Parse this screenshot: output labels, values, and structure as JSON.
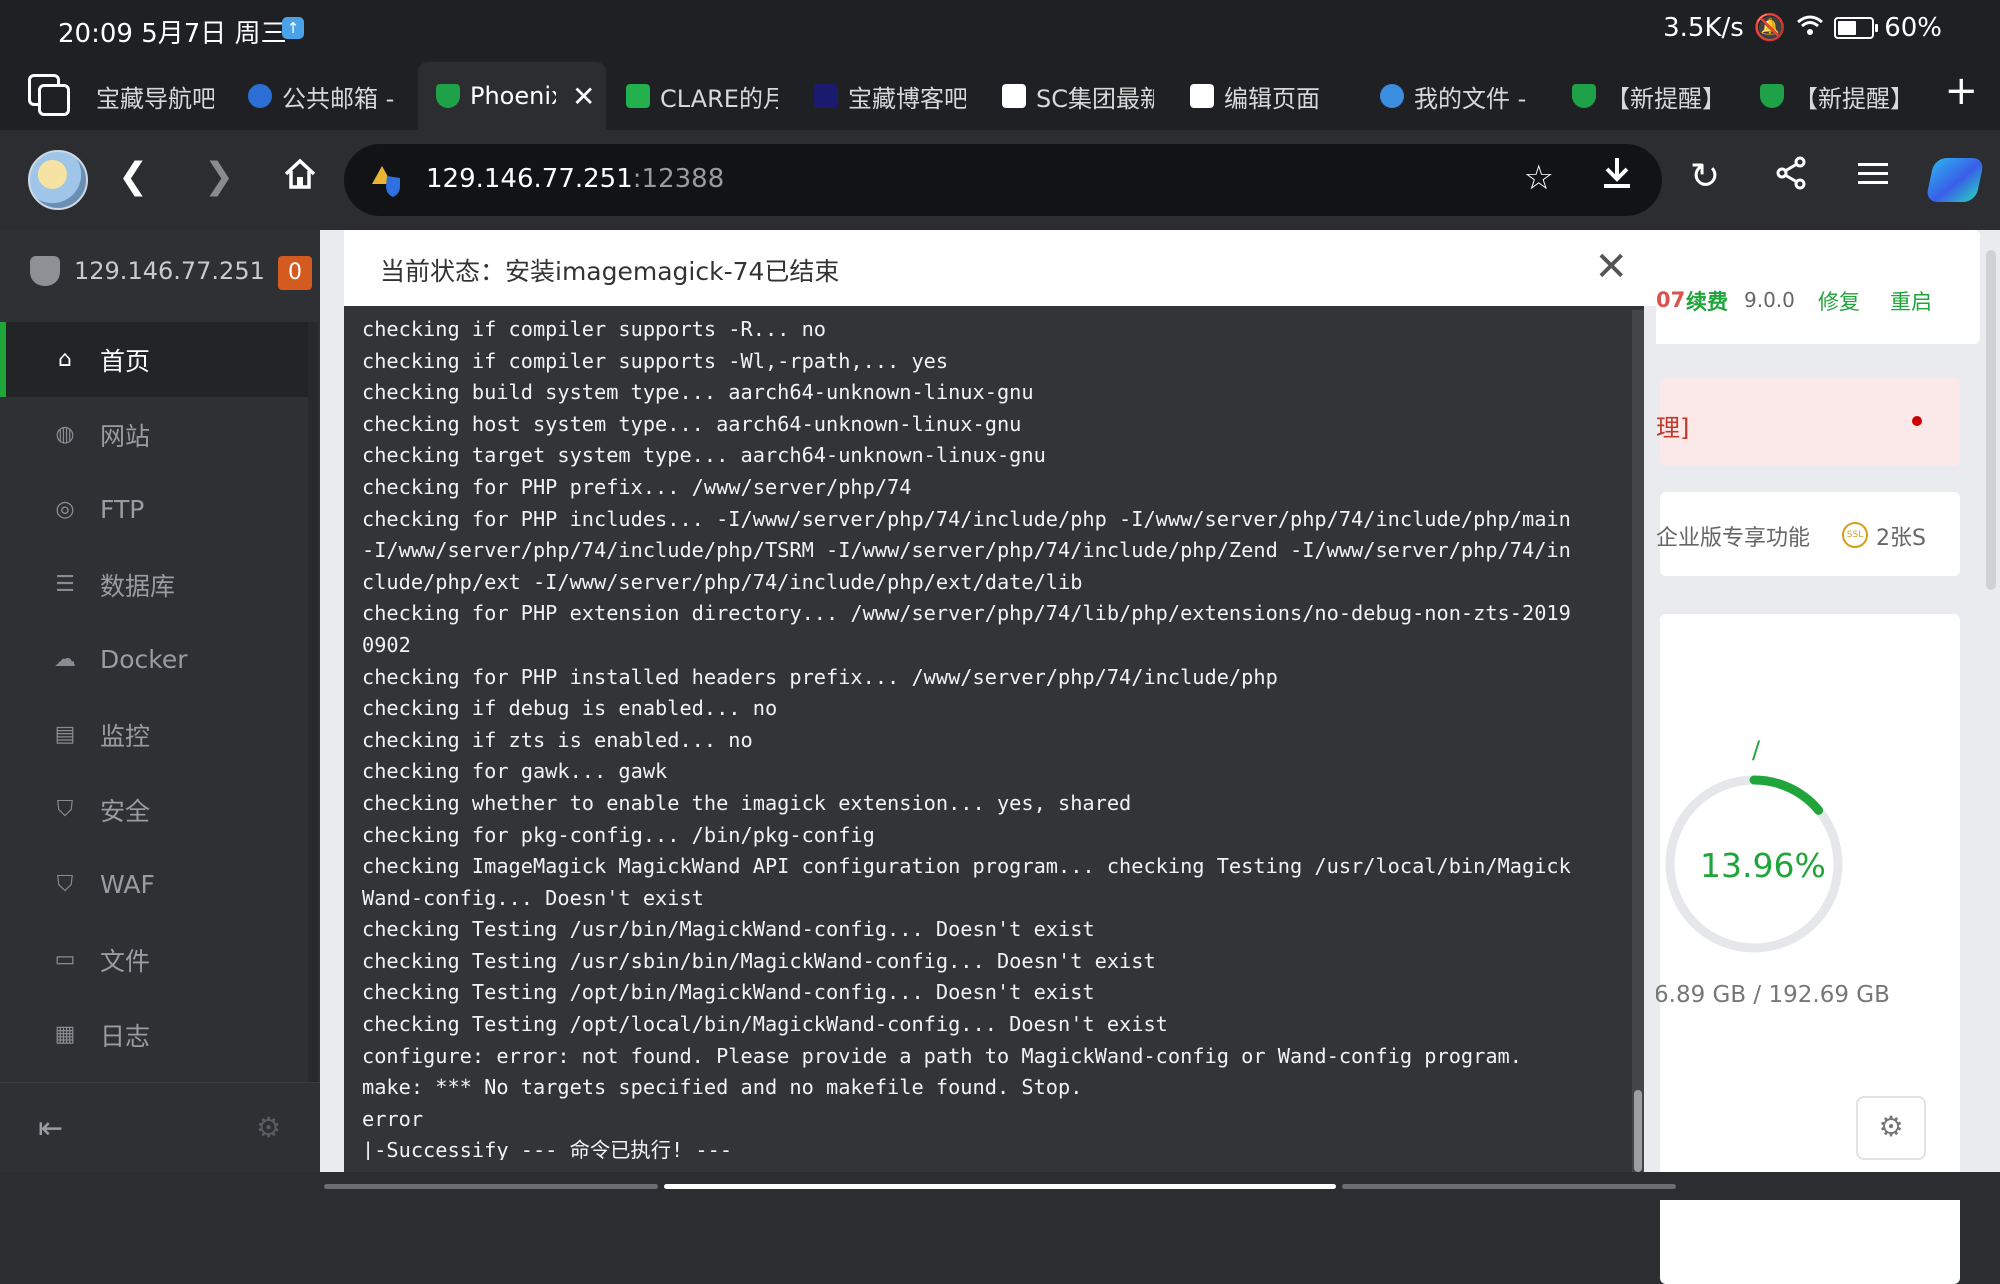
{
  "status_bar": {
    "time": "20:09",
    "date": "5月7日",
    "weekday": "周三",
    "net_speed": "3.5K/s",
    "battery": "60%"
  },
  "tabs": [
    {
      "label": "宝藏导航吧",
      "active": false,
      "favicon_color": "#1f2023"
    },
    {
      "label": "公共邮箱 -",
      "active": false,
      "favicon_color": "#2c6fd6"
    },
    {
      "label": "Phoenix",
      "active": true,
      "favicon_color": "#1fa247"
    },
    {
      "label": "CLARE的月",
      "active": false,
      "favicon_color": "#22b14c"
    },
    {
      "label": "宝藏博客吧",
      "active": false,
      "favicon_color": "#1a1a6e"
    },
    {
      "label": "SC集团最新",
      "active": false,
      "favicon_color": "#ffffff"
    },
    {
      "label": "编辑页面",
      "active": false,
      "favicon_color": "#ffffff"
    },
    {
      "label": "我的文件 -",
      "active": false,
      "favicon_color": "#3b8de0"
    },
    {
      "label": "【新提醒】",
      "active": false,
      "favicon_color": "#1fa247"
    },
    {
      "label": "【新提醒】",
      "active": false,
      "favicon_color": "#1fa247"
    }
  ],
  "address": {
    "host": "129.146.77.251",
    "port": ":12388"
  },
  "sidebar": {
    "server_ip": "129.146.77.251",
    "badge": "0",
    "items": [
      {
        "label": "首页",
        "icon": "home-icon",
        "active": true
      },
      {
        "label": "网站",
        "icon": "globe-icon",
        "active": false
      },
      {
        "label": "FTP",
        "icon": "ftp-icon",
        "active": false
      },
      {
        "label": "数据库",
        "icon": "database-icon",
        "active": false
      },
      {
        "label": "Docker",
        "icon": "docker-icon",
        "active": false
      },
      {
        "label": "监控",
        "icon": "monitor-icon",
        "active": false
      },
      {
        "label": "安全",
        "icon": "shield-icon",
        "active": false
      },
      {
        "label": "WAF",
        "icon": "waf-icon",
        "active": false
      },
      {
        "label": "文件",
        "icon": "folder-icon",
        "active": false
      },
      {
        "label": "日志",
        "icon": "log-icon",
        "active": false
      }
    ]
  },
  "background_panel": {
    "expiry_fragment": "07",
    "renew": "续费",
    "version": "9.0.0",
    "repair": "修复",
    "restart": "重启",
    "alert_fragment": "理]",
    "enterprise": "企业版专享功能",
    "ssl_fragment": "2张S",
    "disk_slash": "/",
    "disk_percent": "13.96%",
    "disk_percent_value": 13.96,
    "disk_usage": "6.89 GB / 192.69 GB"
  },
  "dialog": {
    "title": "当前状态：安装imagemagick-74已结束",
    "lines": [
      "checking if compiler supports -R... no",
      "checking if compiler supports -Wl,-rpath,... yes",
      "checking build system type... aarch64-unknown-linux-gnu",
      "checking host system type... aarch64-unknown-linux-gnu",
      "checking target system type... aarch64-unknown-linux-gnu",
      "checking for PHP prefix... /www/server/php/74",
      "checking for PHP includes... -I/www/server/php/74/include/php -I/www/server/php/74/include/php/main",
      "-I/www/server/php/74/include/php/TSRM -I/www/server/php/74/include/php/Zend -I/www/server/php/74/in",
      "clude/php/ext -I/www/server/php/74/include/php/ext/date/lib",
      "checking for PHP extension directory... /www/server/php/74/lib/php/extensions/no-debug-non-zts-2019",
      "0902",
      "checking for PHP installed headers prefix... /www/server/php/74/include/php",
      "checking if debug is enabled... no",
      "checking if zts is enabled... no",
      "checking for gawk... gawk",
      "checking whether to enable the imagick extension... yes, shared",
      "checking for pkg-config... /bin/pkg-config",
      "checking ImageMagick MagickWand API configuration program... checking Testing /usr/local/bin/Magick",
      "Wand-config... Doesn't exist",
      "checking Testing /usr/bin/MagickWand-config... Doesn't exist",
      "checking Testing /usr/sbin/bin/MagickWand-config... Doesn't exist",
      "checking Testing /opt/bin/MagickWand-config... Doesn't exist",
      "checking Testing /opt/local/bin/MagickWand-config... Doesn't exist",
      "configure: error: not found. Please provide a path to MagickWand-config or Wand-config program.",
      "make: *** No targets specified and no makefile found. Stop.",
      "error",
      "|-Successify --- 命令已执行! ---"
    ]
  },
  "colors": {
    "accent_green": "#20a53a",
    "badge_orange": "#d45b20",
    "dialog_bg": "#333437"
  }
}
